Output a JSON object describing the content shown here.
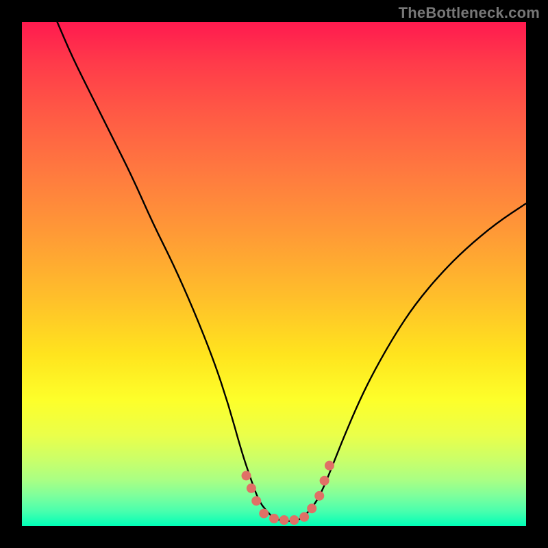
{
  "watermark": "TheBottleneck.com",
  "chart_data": {
    "type": "line",
    "title": "",
    "xlabel": "",
    "ylabel": "",
    "xlim": [
      0,
      100
    ],
    "ylim": [
      0,
      100
    ],
    "grid": false,
    "series": [
      {
        "name": "curve",
        "color": "#000000",
        "x": [
          7,
          10,
          14,
          18,
          22,
          26,
          30,
          34,
          38,
          41,
          43.5,
          45.5,
          47,
          48.5,
          50,
          52,
          54,
          55.5,
          57,
          58.5,
          60,
          62,
          64,
          67,
          70,
          74,
          78,
          83,
          88,
          94,
          100
        ],
        "y": [
          100,
          93,
          85,
          77,
          69,
          60,
          52,
          43,
          33,
          24,
          15,
          9,
          5,
          3,
          1.5,
          1,
          1,
          1.5,
          3,
          5,
          8,
          13,
          18,
          25,
          31,
          38,
          44,
          50,
          55,
          60,
          64
        ]
      }
    ],
    "markers": {
      "name": "trough-markers",
      "color": "#e07066",
      "points": [
        {
          "x": 44.5,
          "y": 10
        },
        {
          "x": 45.5,
          "y": 7.5
        },
        {
          "x": 46.5,
          "y": 5
        },
        {
          "x": 48,
          "y": 2.5
        },
        {
          "x": 50,
          "y": 1.5
        },
        {
          "x": 52,
          "y": 1.2
        },
        {
          "x": 54,
          "y": 1.2
        },
        {
          "x": 56,
          "y": 1.8
        },
        {
          "x": 57.5,
          "y": 3.5
        },
        {
          "x": 59,
          "y": 6
        },
        {
          "x": 60,
          "y": 9
        },
        {
          "x": 61,
          "y": 12
        }
      ],
      "radius_px": 7
    },
    "background": {
      "type": "vertical-gradient",
      "stops": [
        {
          "pos": 0.0,
          "color": "#ff1a4f"
        },
        {
          "pos": 0.3,
          "color": "#ff7a3f"
        },
        {
          "pos": 0.66,
          "color": "#ffe41e"
        },
        {
          "pos": 0.82,
          "color": "#eaff4a"
        },
        {
          "pos": 1.0,
          "color": "#00ffb7"
        }
      ]
    }
  }
}
